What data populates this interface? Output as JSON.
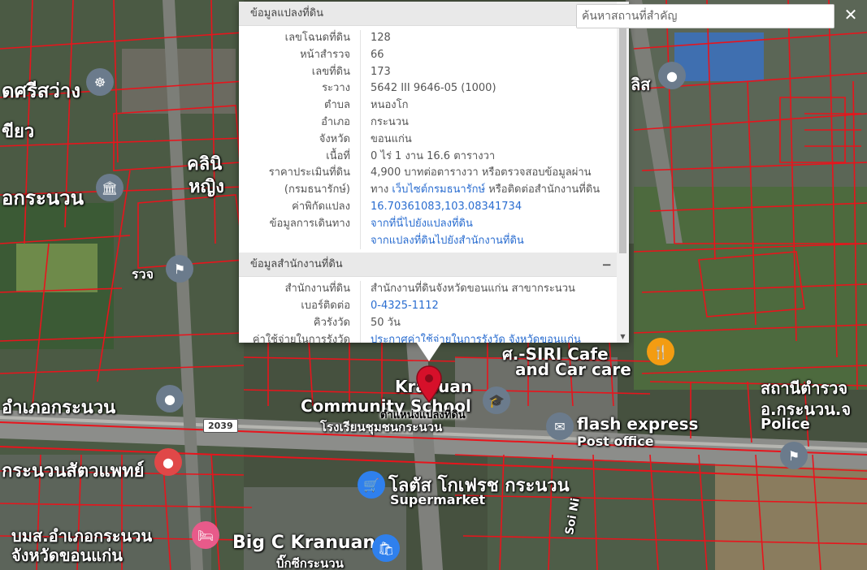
{
  "map": {
    "labels": {
      "sriswang": "ดศรีสว่าง",
      "yo": "ขียว",
      "clinic1": "คลินิ",
      "clinic2": "หญิง",
      "district_office": "อกระนวน",
      "rw": "รวจ",
      "school_en1": "Kranuan",
      "school_en2": "Community School",
      "school_th": "โรงเรียนชุมชนกระนวน",
      "siri_cafe1": "ศ.-SIRI Cafe",
      "siri_cafe2": "and Car care",
      "flash": "flash express",
      "post": "Post office",
      "police_th1": "สถานีตำรวจ",
      "police_th2": "อ.กระนวน.จ",
      "police_en": "Police",
      "amphoe": "อำเภอกระนวน",
      "vet": "กระนวนสัตวแพทย์",
      "lotus_th": "โลตัส โกเฟรช กระนวน",
      "lotus_en": "Supermarket",
      "hospital1": "บมส.อำเภอกระนวน",
      "hospital2": "จังหวัดขอนแก่น",
      "bigc1": "Big C Kranuan",
      "bigc2": "บิ๊กซีกระนวน",
      "soi": "Soi Ni",
      "sl": "ลิส",
      "route": "2039"
    },
    "marker_label": "ตำแหน่งแปลงที่ดิน",
    "colors": {
      "parcel_line": "#e8141c",
      "marker": "#d6102a",
      "poi_blue": "#2f80ed",
      "poi_gray": "#6b7b8c",
      "poi_red": "#e04848",
      "poi_pink": "#e85a8a",
      "poi_orange": "#f39c12"
    }
  },
  "popup": {
    "land": {
      "header": "ข้อมูลแปลงที่ดิน",
      "rows": [
        {
          "k": "เลขโฉนดที่ดิน",
          "v": "128"
        },
        {
          "k": "หน้าสำรวจ",
          "v": "66"
        },
        {
          "k": "เลขที่ดิน",
          "v": "173"
        },
        {
          "k": "ระวาง",
          "v": "5642 III 9646-05 (1000)"
        },
        {
          "k": "ตำบล",
          "v": "หนองโก"
        },
        {
          "k": "อำเภอ",
          "v": "กระนวน"
        },
        {
          "k": "จังหวัด",
          "v": "ขอนแก่น"
        },
        {
          "k": "เนื้อที่",
          "v": "0 ไร่ 1 งาน 16.6 ตารางวา"
        }
      ],
      "price_k": "ราคาประเมินที่ดิน",
      "price_v": "4,900 บาทต่อตารางวา หรือตรวจสอบข้อมูลผ่าน",
      "dept_k": "(กรมธนารักษ์)",
      "dept_v_pre": "ทาง ",
      "dept_link": "เว็บไซต์กรมธนารักษ์",
      "dept_v_post": " หรือติดต่อสำนักงานที่ดิน",
      "coord_k": "ค่าพิกัดแปลง",
      "coord_v": "16.70361083,103.08341734",
      "travel_k": "ข้อมูลการเดินทาง",
      "travel_link1": "จากที่นี่ไปยังแปลงที่ดิน",
      "travel_link2": "จากแปลงที่ดินไปยังสำนักงานที่ดิน"
    },
    "office": {
      "header": "ข้อมูลสำนักงานที่ดิน",
      "collapse": "−",
      "office_k": "สำนักงานที่ดิน",
      "office_v": "สำนักงานที่ดินจังหวัดขอนแก่น สาขากระนวน",
      "phone_k": "เบอร์ติดต่อ",
      "phone_v": "0-4325-1112",
      "queue_k": "คิวรังวัด",
      "queue_v": "50 วัน",
      "cost_k": "ค่าใช้จ่ายในการรังวัด",
      "cost_v": "ประกาศค่าใช้จ่ายในการรังวัด จังหวัดขอนแก่น"
    }
  },
  "search": {
    "placeholder": "ค้นหาสถานที่สำคัญ",
    "close_label": "✕"
  }
}
